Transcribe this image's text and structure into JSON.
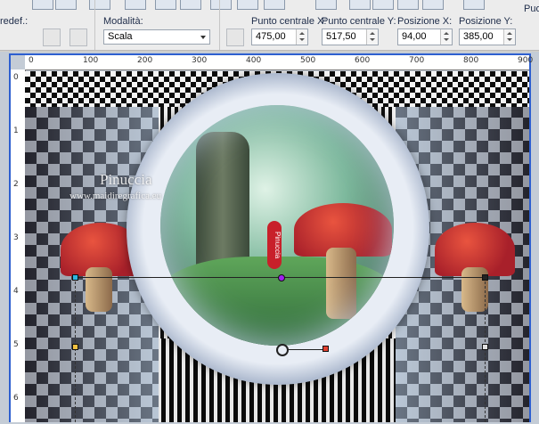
{
  "toolbar": {
    "preset_label": "redef.:",
    "mode_label": "Modalità:",
    "mode_value": "Scala",
    "center_x_label": "Punto centrale X:",
    "center_x_value": "475,00",
    "center_y_label": "Punto centrale Y:",
    "center_y_value": "517,50",
    "pos_x_label": "Posizione X:",
    "pos_x_value": "94,00",
    "pos_y_label": "Posizione Y:",
    "pos_y_value": "385,00",
    "far_right_label": "Puo"
  },
  "ruler": {
    "h_ticks": [
      "0",
      "100",
      "200",
      "300",
      "400",
      "500",
      "600",
      "700",
      "800",
      "900"
    ],
    "v_ticks": [
      "0",
      "1",
      "2",
      "3",
      "4",
      "5",
      "6"
    ]
  },
  "watermark": {
    "name": "Pinuccia",
    "site": "www.maidiregrafica.eu",
    "tag": "Pinuccia"
  },
  "colors": {
    "selection_frame": "#2d5fd0",
    "toolbar_bg": "#ececec"
  }
}
